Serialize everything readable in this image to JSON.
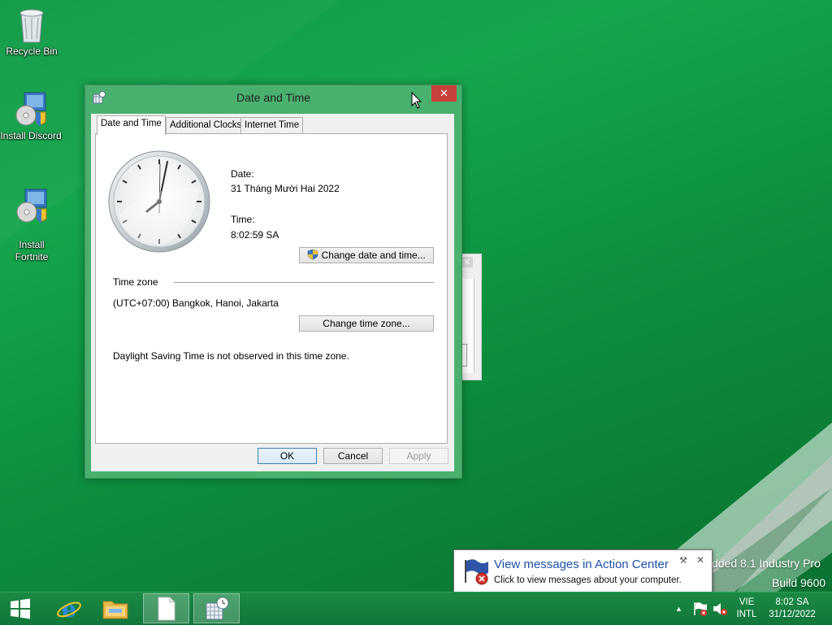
{
  "desktop": {
    "icons": [
      {
        "label": "Recycle Bin"
      },
      {
        "label": "Install Discord"
      },
      {
        "label": "Install\nFortnite"
      }
    ],
    "watermark": {
      "line1": "dded 8.1 Industry Pro",
      "line2": "Build 9600"
    }
  },
  "dialog": {
    "title": "Date and Time",
    "close": "✕",
    "tabs": [
      "Date and Time",
      "Additional Clocks",
      "Internet Time"
    ],
    "active_tab": "Date and Time",
    "date_label": "Date:",
    "date_value": "31 Tháng Mười Hai 2022",
    "time_label": "Time:",
    "time_value": "8:02:59 SA",
    "change_datetime_button": "Change date and time...",
    "timezone_header": "Time zone",
    "timezone_value": "(UTC+07:00) Bangkok, Hanoi, Jakarta",
    "change_timezone_button": "Change time zone...",
    "dst_note": "Daylight Saving Time is not observed in this time zone.",
    "ok": "OK",
    "cancel": "Cancel",
    "apply": "Apply"
  },
  "behind_window": {
    "close": "✕"
  },
  "notification": {
    "title": "View messages in Action Center",
    "body": "Click to view messages about your computer.",
    "close": "✕"
  },
  "taskbar": {
    "language_line1": "VIE",
    "language_line2": "INTL",
    "clock_time": "8:02 SA",
    "clock_date": "31/12/2022",
    "tray_arrow": "▲"
  },
  "colors": {
    "desktop_green": "#109a46",
    "window_frame": "#49b06e",
    "close_red": "#c8403a",
    "link_blue": "#1b50a5"
  }
}
